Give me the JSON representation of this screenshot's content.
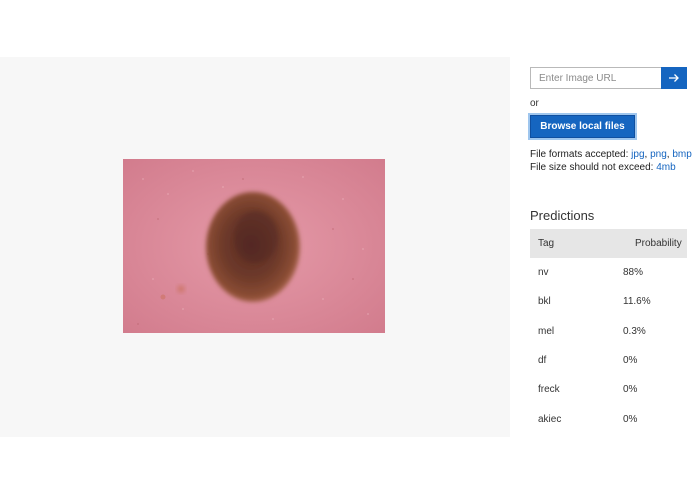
{
  "image": {
    "alt": "skin lesion"
  },
  "upload": {
    "url_placeholder": "Enter Image URL",
    "go_icon": "arrow-right-icon",
    "or_label": "or",
    "browse_label": "Browse local files",
    "formats_prefix": "File formats accepted: ",
    "formats": [
      "jpg",
      "png",
      "bmp"
    ],
    "size_prefix": "File size should not exceed: ",
    "size_limit": "4mb"
  },
  "predictions": {
    "title": "Predictions",
    "columns": [
      "Tag",
      "Probability"
    ],
    "rows": [
      {
        "tag": "nv",
        "probability": "88%"
      },
      {
        "tag": "bkl",
        "probability": "11.6%"
      },
      {
        "tag": "mel",
        "probability": "0.3%"
      },
      {
        "tag": "df",
        "probability": "0%"
      },
      {
        "tag": "freck",
        "probability": "0%"
      },
      {
        "tag": "akiec",
        "probability": "0%"
      }
    ]
  },
  "colors": {
    "accent": "#1565c0",
    "panel_bg": "#f7f7f7",
    "table_header_bg": "#e6e6e6"
  }
}
